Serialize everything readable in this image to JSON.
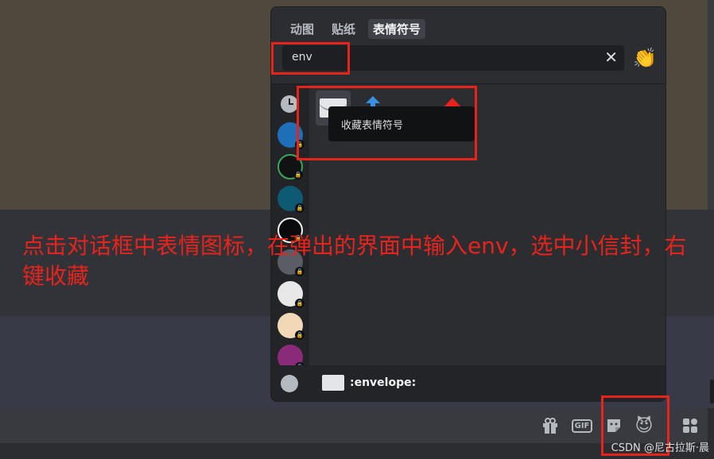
{
  "picker": {
    "tabs": [
      {
        "label": "动图",
        "active": false
      },
      {
        "label": "贴纸",
        "active": false
      },
      {
        "label": "表情符号",
        "active": true
      }
    ],
    "search": {
      "value": "env",
      "clear_icon": "close-icon"
    },
    "skin_tone_icon": "clapping-hands-icon",
    "skin_tone_glyph": "👏",
    "sidebar_icons": [
      "clock-icon",
      "server-icon",
      "server-icon",
      "server-icon",
      "server-icon",
      "server-icon",
      "server-icon",
      "server-icon",
      "server-icon"
    ],
    "tooltip": {
      "text": "收藏表情符号"
    },
    "footer": {
      "emoji_name": ":envelope:",
      "smiley_icon": "smiley-icon"
    }
  },
  "chat_bar": {
    "icons": [
      "gift-icon",
      "gif-icon",
      "sticker-icon",
      "emoji-icon",
      "apps-icon"
    ],
    "gif_label": "GIF",
    "emoji_glyph": "😈"
  },
  "annotation": {
    "text": "点击对话框中表情图标，在弹出的界面中输入env，选中小信封，右键收藏"
  },
  "watermark": "CSDN @尼古拉斯·晨"
}
